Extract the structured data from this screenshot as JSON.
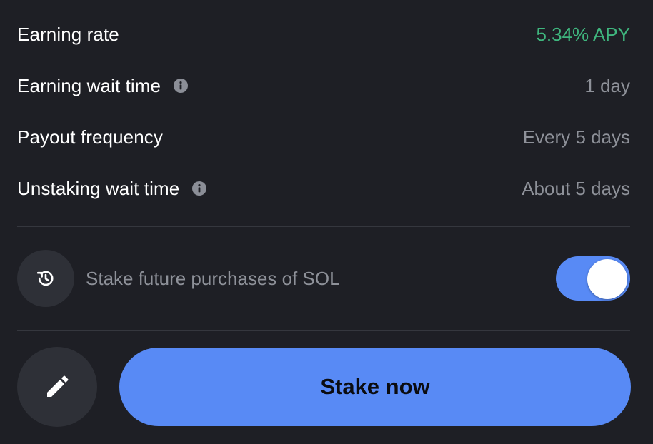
{
  "details": {
    "rows": [
      {
        "label": "Earning rate",
        "value": "5.34% APY",
        "has_info": false
      },
      {
        "label": "Earning wait time",
        "value": "1 day",
        "has_info": true
      },
      {
        "label": "Payout frequency",
        "value": "Every 5 days",
        "has_info": false
      },
      {
        "label": "Unstaking wait time",
        "value": "About 5 days",
        "has_info": true
      }
    ]
  },
  "auto_stake": {
    "label": "Stake future purchases of SOL",
    "enabled": true,
    "icon": "history-icon"
  },
  "actions": {
    "edit_icon": "pencil-icon",
    "stake_label": "Stake now"
  },
  "colors": {
    "background": "#1e1f25",
    "accent": "#588af5",
    "positive": "#3fb67e",
    "muted_text": "#8e9199"
  }
}
